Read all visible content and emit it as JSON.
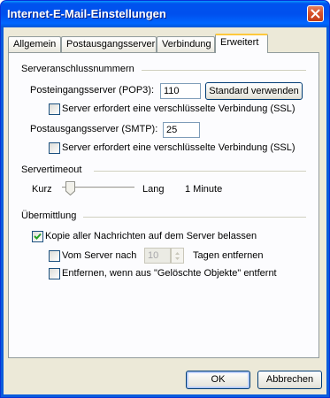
{
  "window": {
    "title": "Internet-E-Mail-Einstellungen"
  },
  "tabs": [
    {
      "label": "Allgemein"
    },
    {
      "label": "Postausgangsserver"
    },
    {
      "label": "Verbindung"
    },
    {
      "label": "Erweitert",
      "active": true
    }
  ],
  "server_ports": {
    "heading": "Serveranschlussnummern",
    "incoming_label": "Posteingangsserver (POP3):",
    "incoming_value": "110",
    "default_button": "Standard verwenden",
    "incoming_ssl_label": "Server erfordert eine verschlüsselte Verbindung (SSL)",
    "incoming_ssl_checked": false,
    "outgoing_label": "Postausgangsserver (SMTP):",
    "outgoing_value": "25",
    "outgoing_ssl_label": "Server erfordert eine verschlüsselte Verbindung (SSL)",
    "outgoing_ssl_checked": false
  },
  "timeout": {
    "heading": "Servertimeout",
    "short_label": "Kurz",
    "long_label": "Lang",
    "value_text": "1 Minute",
    "slider_level": 0.05
  },
  "delivery": {
    "heading": "Übermittlung",
    "keep_copy_label": "Kopie aller Nachrichten auf dem Server belassen",
    "keep_copy_checked": true,
    "remove_after_label": "Vom Server nach",
    "remove_after_checked": false,
    "remove_after_value": "10",
    "remove_after_suffix": "Tagen entfernen",
    "remove_deleted_label": "Entfernen, wenn aus \"Gelöschte Objekte\" entfernt",
    "remove_deleted_checked": false
  },
  "buttons": {
    "ok": "OK",
    "cancel": "Abbrechen"
  },
  "colors": {
    "titlebar": "#0054e3",
    "face": "#ece9d8",
    "panel": "#fcfcfe",
    "check_mark": "#21a121",
    "close_button": "#d8522b"
  },
  "icons": [
    "close-icon",
    "checkmark-icon",
    "slider-thumb-icon",
    "spin-up-icon",
    "spin-down-icon"
  ]
}
